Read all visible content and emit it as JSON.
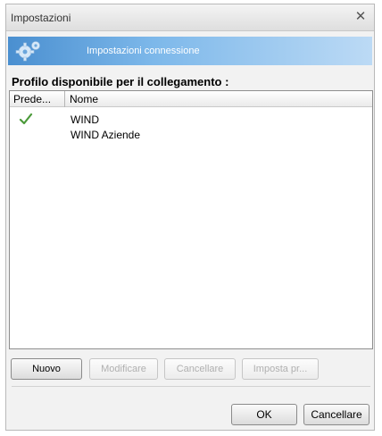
{
  "window": {
    "title": "Impostazioni",
    "close_glyph": "✕"
  },
  "banner": {
    "title": "Impostazioni connessione",
    "icon": "gear-icon",
    "color": "#4a8fd0"
  },
  "section": {
    "label": "Profilo disponibile per il collegamento :"
  },
  "list": {
    "columns": {
      "default": "Prede...",
      "name": "Nome"
    },
    "rows": [
      {
        "name": "WIND",
        "is_default": true
      },
      {
        "name": "WIND Aziende",
        "is_default": false
      }
    ]
  },
  "actions": {
    "new": "Nuovo",
    "modify": "Modificare",
    "delete": "Cancellare",
    "set_default": "Imposta pr..."
  },
  "footer": {
    "ok": "OK",
    "cancel": "Cancellare"
  }
}
